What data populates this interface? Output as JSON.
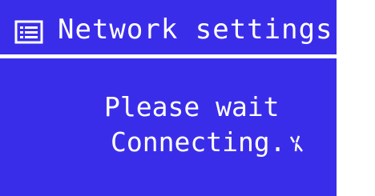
{
  "header": {
    "title": "Network settings",
    "icon": "menu-list-icon"
  },
  "message": {
    "line1": "Please wait",
    "line2": "Connecting."
  },
  "indicator": {
    "icon": "busy-spinner-icon"
  },
  "colors": {
    "screen_bg": "#3a2dea",
    "text": "#ffffff"
  }
}
